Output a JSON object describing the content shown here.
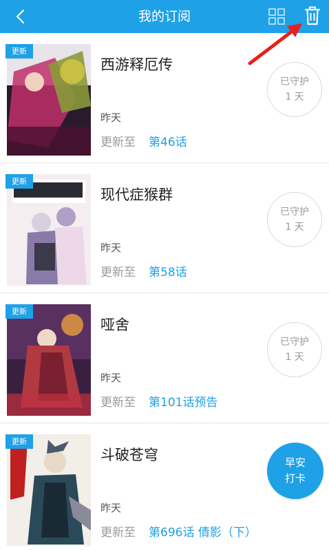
{
  "header": {
    "title": "我的订阅",
    "back_icon": "chevron-left-icon",
    "grid_icon": "grid-view-icon",
    "delete_icon": "trash-icon"
  },
  "badge_label": "更新",
  "update_prefix": "更新至",
  "comics": [
    {
      "name": "西游释厄传",
      "date": "昨天",
      "chapter": "第46话",
      "guard_line1": "已守护",
      "guard_line2": "1 天",
      "cover_colors": [
        "#2a1a2e",
        "#c0306a",
        "#8a9a3a"
      ]
    },
    {
      "name": "现代症猴群",
      "date": "昨天",
      "chapter": "第58话",
      "guard_line1": "已守护",
      "guard_line2": "1 天",
      "cover_colors": [
        "#f4eef0",
        "#8a7aa8",
        "#3a3a4a"
      ]
    },
    {
      "name": "哑舍",
      "date": "昨天",
      "chapter": "第101话预告",
      "guard_line1": "已守护",
      "guard_line2": "1 天",
      "cover_colors": [
        "#3a2040",
        "#b03a40",
        "#e8a040"
      ]
    },
    {
      "name": "斗破苍穹",
      "date": "昨天",
      "chapter": "第696话 倩影（下）",
      "cover_colors": [
        "#f2eee8",
        "#2a4a5a",
        "#c02020"
      ]
    }
  ],
  "checkin": {
    "line1": "早安",
    "line2": "打卡"
  },
  "colors": {
    "accent": "#1ea1e7",
    "annotation_arrow": "#e8201c"
  }
}
